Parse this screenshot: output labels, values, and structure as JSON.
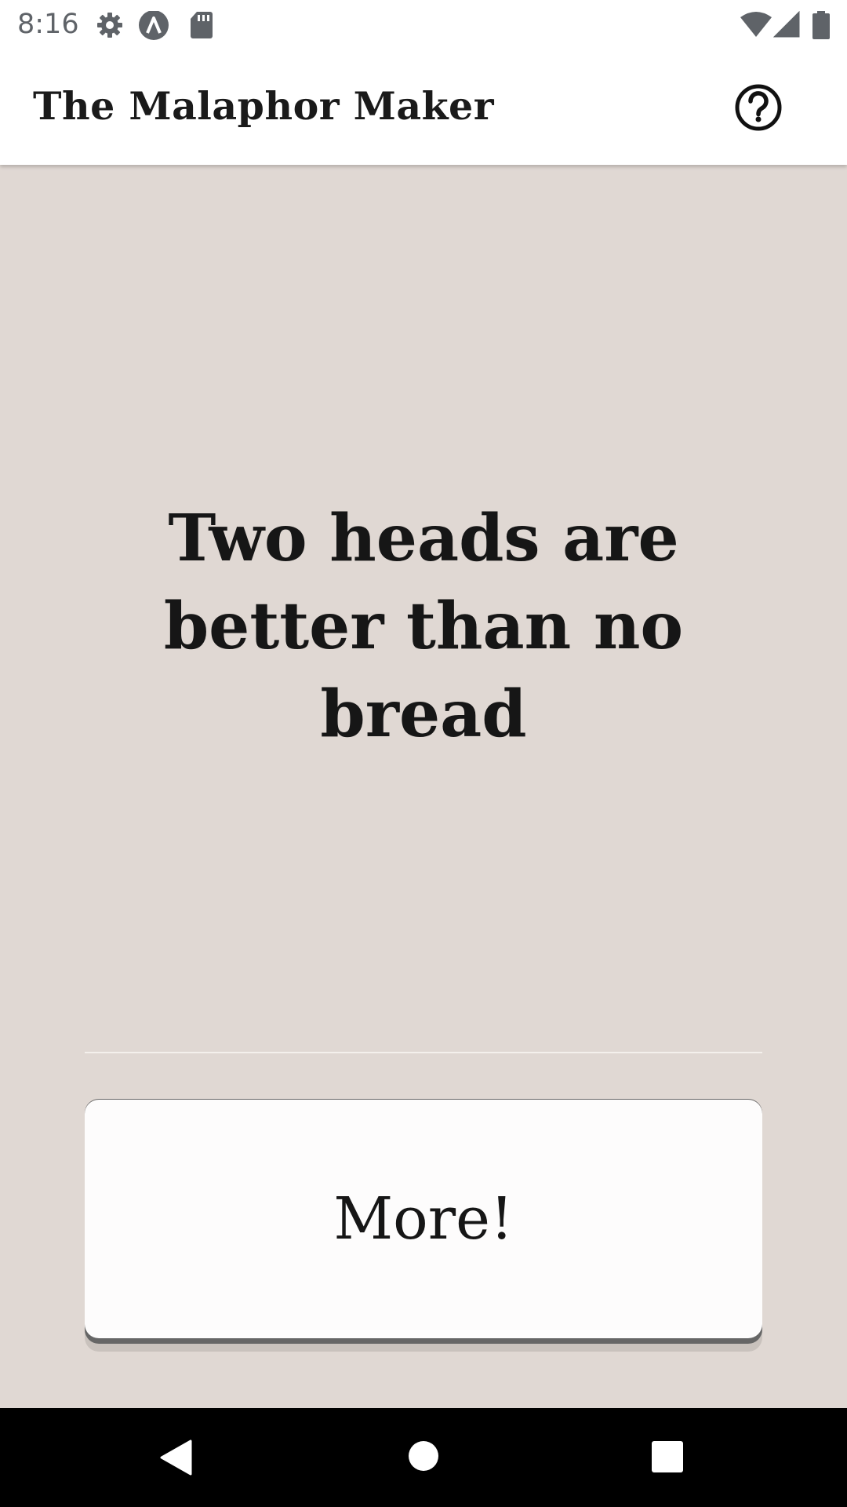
{
  "status_bar": {
    "time": "8:16",
    "left_icons": [
      "settings-gear-icon",
      "a-badge-icon",
      "sd-card-icon"
    ],
    "right_icons": [
      "wifi-icon",
      "signal-icon",
      "battery-icon"
    ]
  },
  "app_bar": {
    "title": "The Malaphor Maker",
    "help_icon": "question-circle-icon"
  },
  "main": {
    "malaphor_text": "Two heads are better than no bread",
    "more_button_label": "More!"
  },
  "nav_bar": {
    "buttons": [
      "back-icon",
      "home-icon",
      "recents-icon"
    ]
  },
  "colors": {
    "background": "#e0d8d3",
    "app_bar": "#ffffff",
    "text": "#161616",
    "button": "#fdfcfc",
    "nav_bar": "#000000"
  }
}
